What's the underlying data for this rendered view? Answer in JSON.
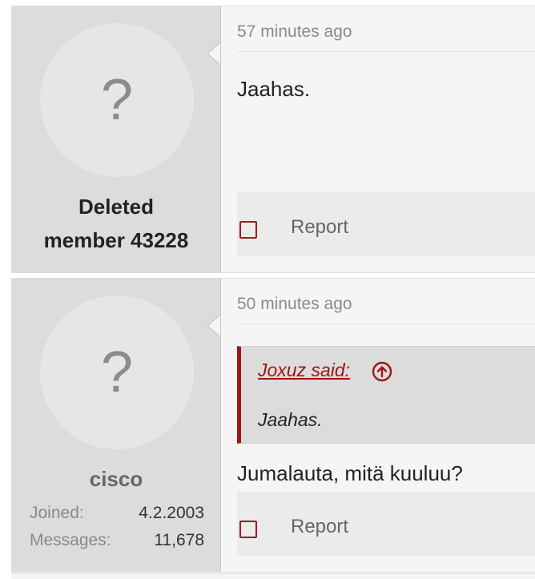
{
  "posts": [
    {
      "username": "Deleted member 43228",
      "username_line1": "Deleted",
      "username_line2": "member 43228",
      "avatar_glyph": "?",
      "date": "57 minutes ago",
      "message": "Jaahas.",
      "report_label": "Report"
    },
    {
      "username": "cisco",
      "avatar_glyph": "?",
      "stats": [
        {
          "label": "Joined:",
          "value": "4.2.2003"
        },
        {
          "label": "Messages:",
          "value": "11,678"
        }
      ],
      "date": "50 minutes ago",
      "quote": {
        "author": "Joxuz said:",
        "up_icon": "arrow-up-circle-icon",
        "text": "Jaahas."
      },
      "message": "Jumalauta, mitä kuuluu?",
      "report_label": "Report"
    }
  ],
  "colors": {
    "accent": "#a01414",
    "user_cell_bg": "#dcdcdc",
    "post_bg": "#f5f5f5"
  }
}
